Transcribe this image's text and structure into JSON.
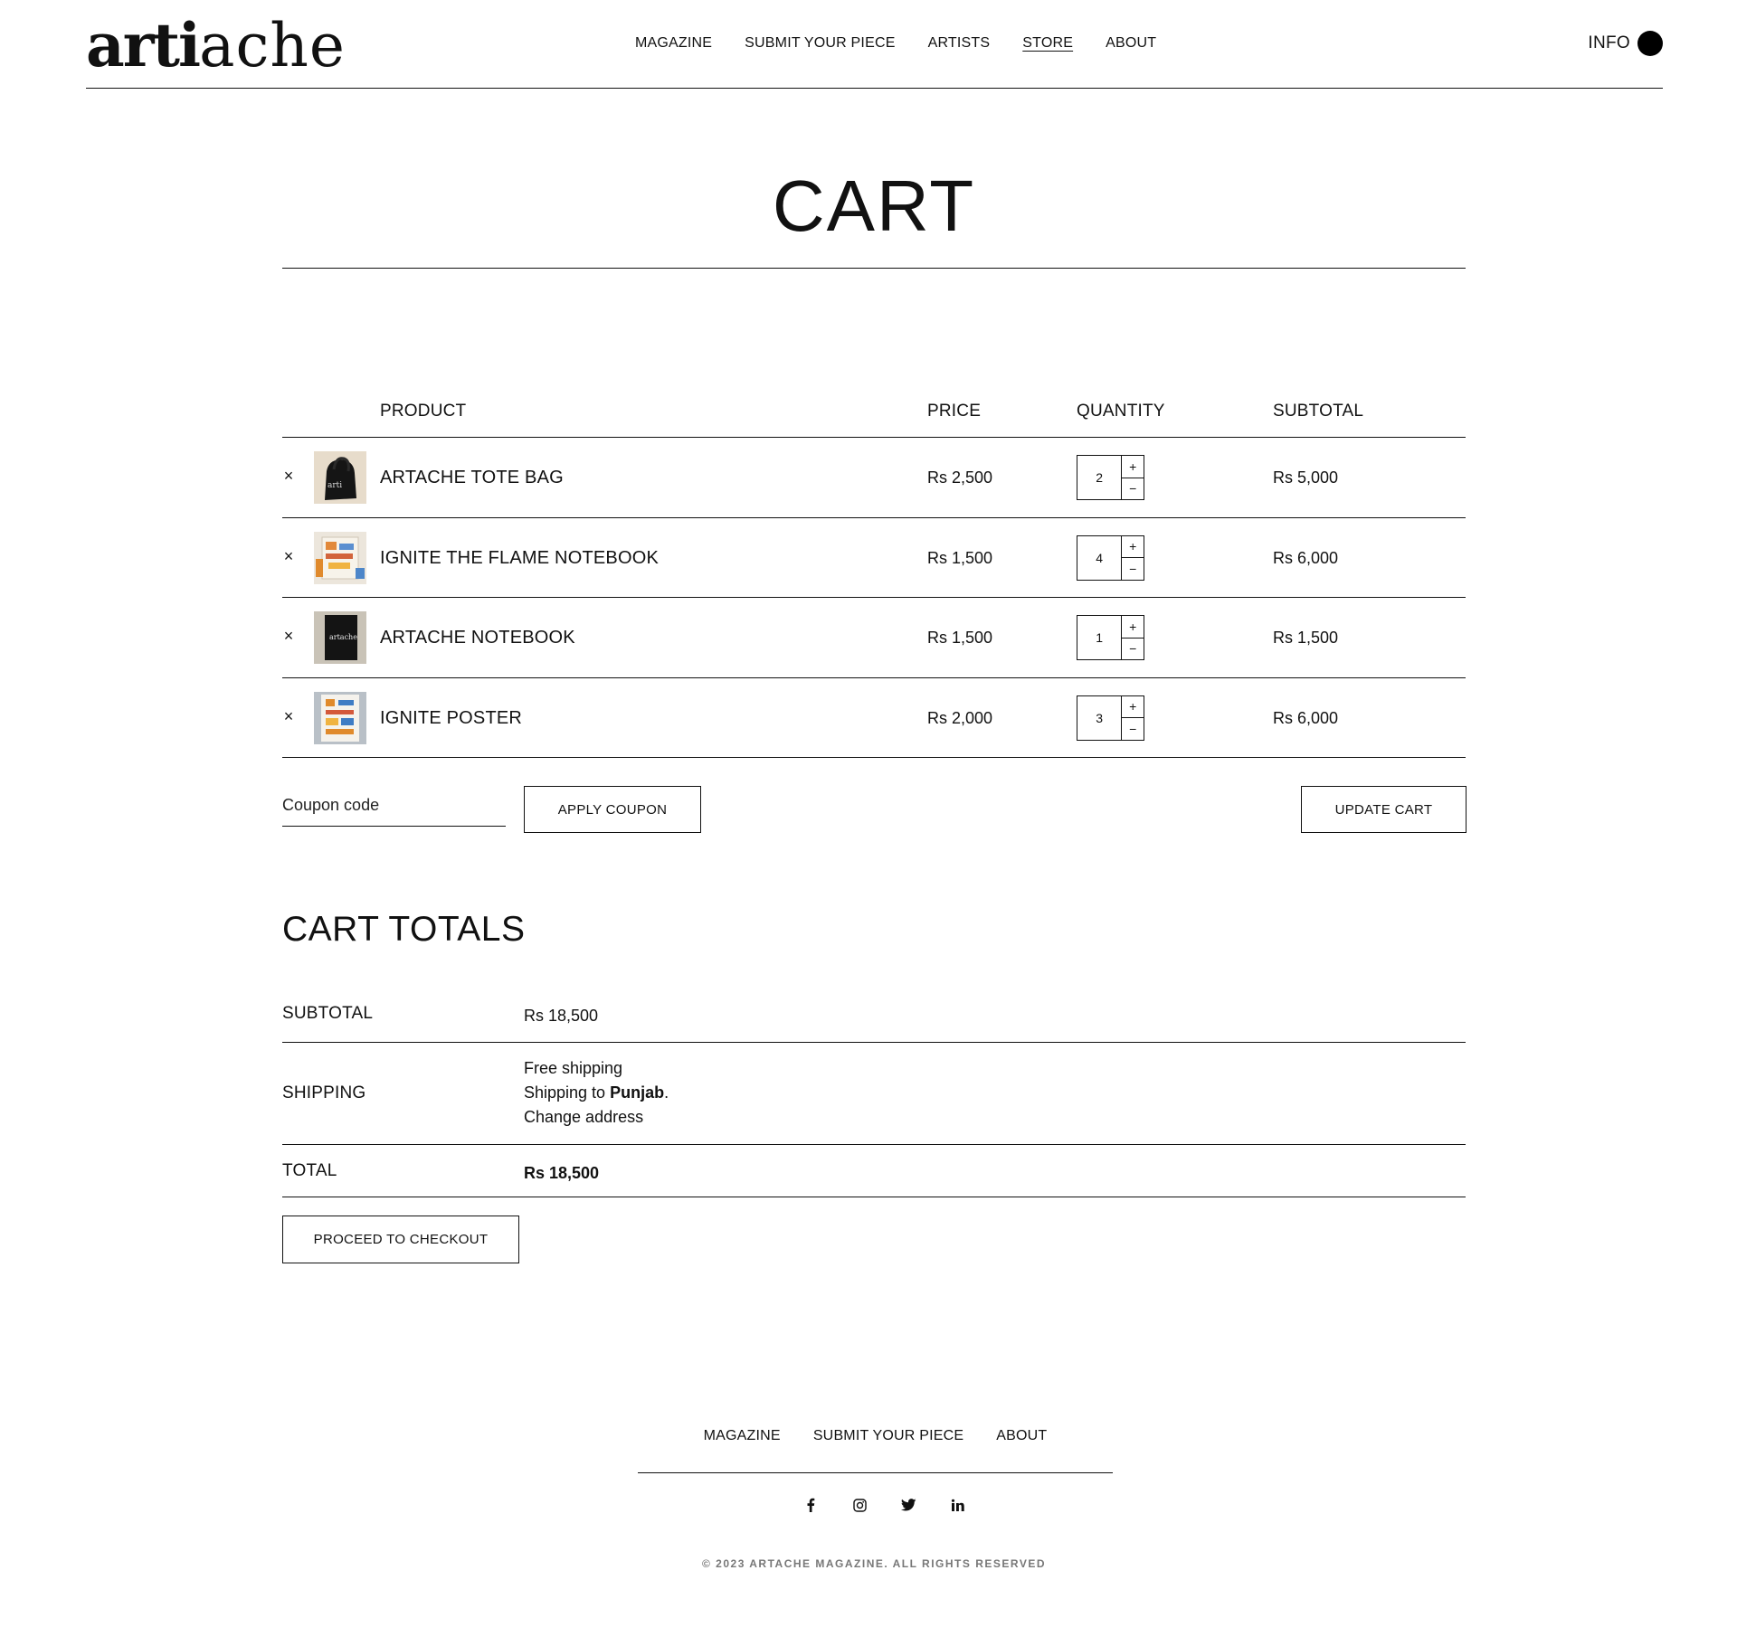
{
  "header": {
    "logo_part1": "arti",
    "logo_part2": "ache",
    "nav": [
      "MAGAZINE",
      "SUBMIT YOUR PIECE",
      "ARTISTS",
      "STORE",
      "ABOUT"
    ],
    "info_label": "INFO"
  },
  "page_title": "CART",
  "cart": {
    "columns": {
      "product": "PRODUCT",
      "price": "PRICE",
      "quantity": "QUANTITY",
      "subtotal": "SUBTOTAL"
    },
    "remove_symbol": "×",
    "plus_symbol": "+",
    "minus_symbol": "−",
    "items": [
      {
        "name": "ARTACHE TOTE BAG",
        "price": "Rs 2,500",
        "qty": "2",
        "subtotal": "Rs 5,000",
        "thumb": "tote-bag-photo"
      },
      {
        "name": "IGNITE THE FLAME NOTEBOOK",
        "price": "Rs 1,500",
        "qty": "4",
        "subtotal": "Rs 6,000",
        "thumb": "flame-notebook-photo"
      },
      {
        "name": "ARTACHE NOTEBOOK",
        "price": "Rs 1,500",
        "qty": "1",
        "subtotal": "Rs 1,500",
        "thumb": "black-notebook-photo"
      },
      {
        "name": "IGNITE POSTER",
        "price": "Rs 2,000",
        "qty": "3",
        "subtotal": "Rs 6,000",
        "thumb": "poster-photo"
      }
    ],
    "coupon_placeholder": "Coupon code",
    "apply_coupon": "APPLY COUPON",
    "update_cart": "UPDATE CART"
  },
  "totals": {
    "title": "CART TOTALS",
    "subtotal_label": "SUBTOTAL",
    "subtotal_value": "Rs 18,500",
    "shipping_label": "SHIPPING",
    "shipping_line1": "Free shipping",
    "shipping_to_prefix": "Shipping to ",
    "shipping_region": "Punjab",
    "shipping_to_suffix": ".",
    "change_address": "Change address",
    "total_label": "TOTAL",
    "total_value": "Rs 18,500",
    "checkout": "PROCEED TO CHECKOUT"
  },
  "footer": {
    "nav": [
      "MAGAZINE",
      "SUBMIT YOUR PIECE",
      "ABOUT"
    ],
    "social_icons": [
      "facebook-icon",
      "instagram-icon",
      "twitter-icon",
      "linkedin-icon"
    ],
    "copyright": "© 2023 ARTACHE MAGAZINE. ALL RIGHTS RESERVED"
  }
}
